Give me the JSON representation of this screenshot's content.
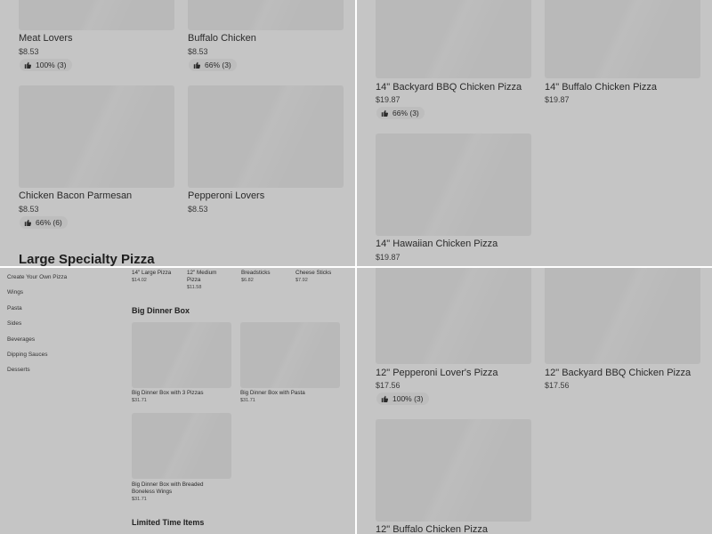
{
  "top_left": {
    "items": [
      {
        "name": "Meat Lovers",
        "price": "$8.53",
        "rating": "100% (3)"
      },
      {
        "name": "Buffalo Chicken",
        "price": "$8.53",
        "rating": "66% (3)"
      },
      {
        "name": "Chicken Bacon Parmesan",
        "price": "$8.53",
        "rating": "66% (6)"
      },
      {
        "name": "Pepperoni Lovers",
        "price": "$8.53"
      }
    ],
    "section_title": "Large Specialty Pizza"
  },
  "top_right": {
    "items": [
      {
        "name": "14\" Backyard BBQ Chicken Pizza",
        "price": "$19.87",
        "rating": "66% (3)"
      },
      {
        "name": "14\" Buffalo Chicken Pizza",
        "price": "$19.87"
      },
      {
        "name": "14\" Hawaiian Chicken Pizza",
        "price": "$19.87"
      }
    ]
  },
  "bottom_left": {
    "sidebar": [
      "Create Your Own Pizza",
      "Wings",
      "Pasta",
      "Sides",
      "Beverages",
      "Dipping Sauces",
      "Desserts"
    ],
    "top_row": [
      {
        "name": "14\" Large Pizza",
        "price": "$14.02"
      },
      {
        "name": "12\" Medium Pizza",
        "price": "$11.58"
      },
      {
        "name": "Breadsticks",
        "price": "$6.82"
      },
      {
        "name": "Cheese Sticks",
        "price": "$7.92"
      }
    ],
    "section_title": "Big Dinner Box",
    "items": [
      {
        "name": "Big Dinner Box with 3 Pizzas",
        "price": "$31.71"
      },
      {
        "name": "Big Dinner Box with Pasta",
        "price": "$31.71"
      },
      {
        "name": "Big Dinner Box with Breaded Boneless Wings",
        "price": "$31.71"
      }
    ],
    "next_section_title": "Limited Time Items"
  },
  "bottom_right": {
    "items": [
      {
        "name": "12\" Pepperoni Lover's Pizza",
        "price": "$17.56",
        "rating": "100% (3)"
      },
      {
        "name": "12\" Backyard BBQ Chicken Pizza",
        "price": "$17.56"
      },
      {
        "name": "12\" Buffalo Chicken Pizza"
      }
    ]
  },
  "icons": {
    "rating_icon": "thumbs-up-icon"
  }
}
